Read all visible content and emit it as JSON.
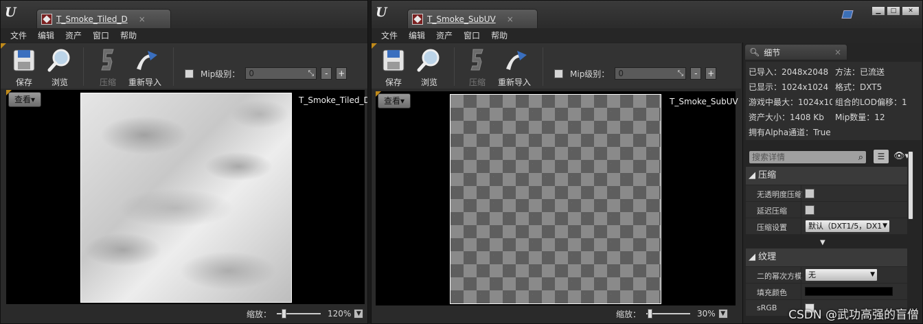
{
  "window1": {
    "tab_title": "T_Smoke_Tiled_D",
    "tab_close": "×",
    "menu": [
      "文件",
      "编辑",
      "资产",
      "窗口",
      "帮助"
    ],
    "tools": {
      "save": "保存",
      "browse": "浏览",
      "compress": "压缩",
      "reimport": "重新导入"
    },
    "mip_label": "Mip级别：",
    "mip_value": "0",
    "minus": "-",
    "plus": "+",
    "view_button": "查看▾",
    "texture_name": "T_Smoke_Tiled_D",
    "zoom_label": "缩放：",
    "zoom_value": "120%",
    "zoom_fraction": 0.12
  },
  "window2": {
    "tab_title": "T_Smoke_SubUV",
    "tab_close": "×",
    "menu": [
      "文件",
      "编辑",
      "资产",
      "窗口",
      "帮助"
    ],
    "tools": {
      "save": "保存",
      "browse": "浏览",
      "compress": "压缩",
      "reimport": "重新导入"
    },
    "mip_label": "Mip级别：",
    "mip_value": "0",
    "minus": "-",
    "plus": "+",
    "view_button": "查看▾",
    "texture_name": "T_Smoke_SubUV",
    "zoom_label": "缩放：",
    "zoom_value": "30%",
    "zoom_fraction": 0.03,
    "window_buttons": {
      "minimize": "▁",
      "maximize": "□",
      "close": "✕"
    }
  },
  "details": {
    "tab_title": "细节",
    "tab_close": "×",
    "info": {
      "imported": "已导入：2048x2048",
      "method": "方法：已流送",
      "displayed": "已显示：1024x1024",
      "format": "格式：DXT5",
      "game_max": "游戏中最大：1024x10",
      "lod_bias": "组合的LOD偏移：1",
      "resource_size": "资产大小：1408 Kb",
      "mip_count": "Mip数量：12",
      "has_alpha": "拥有Alpha通道：True"
    },
    "search_placeholder": "搜索详情",
    "sections": {
      "compression": "◢ 压缩",
      "texture": "◢ 纹理"
    },
    "props": {
      "no_alpha": "无透明度压缩",
      "defer": "延迟压缩",
      "settings": "压缩设置",
      "settings_value": "默认（DXT1/5，DX1",
      "pow2": "二的幂次方模",
      "pow2_value": "无",
      "fill_color": "填充颜色",
      "fill_color_hex": "#000000",
      "srgb": "sRGB"
    }
  },
  "watermark": "CSDN @武功高强的盲僧"
}
